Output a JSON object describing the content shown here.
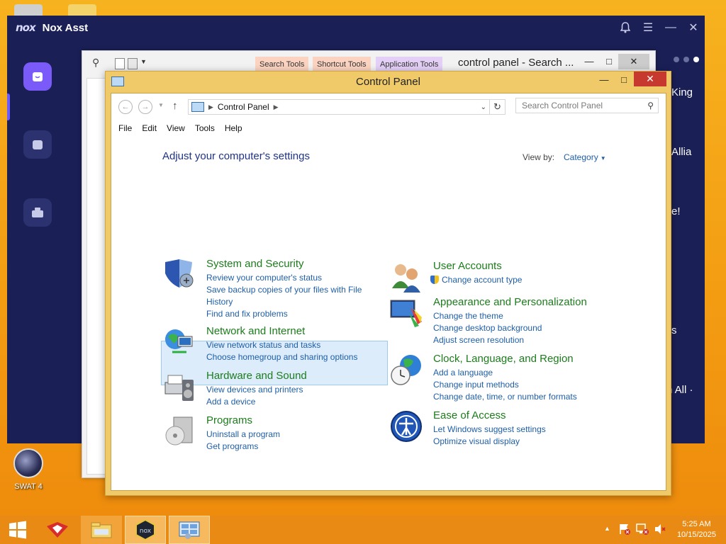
{
  "nox": {
    "title": "Nox Asst",
    "logo": "nox",
    "right_texts": [
      "King",
      "Allia",
      "e!",
      "s",
      "n All ·"
    ],
    "right_top_text": "s"
  },
  "explorer": {
    "tabs": [
      "Search Tools",
      "Shortcut Tools",
      "Application Tools"
    ],
    "title": "control panel - Search ..."
  },
  "control_panel": {
    "title": "Control Panel",
    "address": "Control Panel",
    "search_placeholder": "Search Control Panel",
    "menu": [
      "File",
      "Edit",
      "View",
      "Tools",
      "Help"
    ],
    "heading": "Adjust your computer's settings",
    "view_by_label": "View by:",
    "view_by_value": "Category",
    "categories_left": [
      {
        "title": "System and Security",
        "links": [
          "Review your computer's status",
          "Save backup copies of your files with File",
          "History",
          "Find and fix problems"
        ]
      },
      {
        "title": "Network and Internet",
        "links": [
          "View network status and tasks",
          "Choose homegroup and sharing options"
        ]
      },
      {
        "title": "Hardware and Sound",
        "links": [
          "View devices and printers",
          "Add a device"
        ]
      },
      {
        "title": "Programs",
        "links": [
          "Uninstall a program",
          "Get programs"
        ]
      }
    ],
    "categories_right": [
      {
        "title": "User Accounts",
        "links": [
          "Change account type"
        ]
      },
      {
        "title": "Appearance and Personalization",
        "links": [
          "Change the theme",
          "Change desktop background",
          "Adjust screen resolution"
        ]
      },
      {
        "title": "Clock, Language, and Region",
        "links": [
          "Add a language",
          "Change input methods",
          "Change date, time, or number formats"
        ]
      },
      {
        "title": "Ease of Access",
        "links": [
          "Let Windows suggest settings",
          "Optimize visual display"
        ]
      }
    ]
  },
  "desktop": {
    "icon_label": "SWAT 4"
  },
  "taskbar": {
    "time": "5:25 AM",
    "date": "10/15/2025"
  },
  "colors": {
    "desktop": "#f39c12",
    "nox_bg": "#1a1f56",
    "cp_frame": "#f0c969",
    "link": "#1f5fa8",
    "category_title": "#1b7d1b",
    "heading": "#1e3287"
  }
}
